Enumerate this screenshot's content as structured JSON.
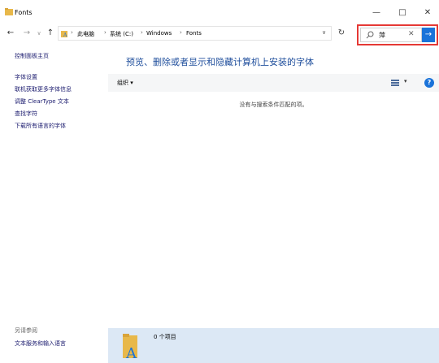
{
  "window": {
    "title": "Fonts",
    "minimize_glyph": "—",
    "maximize_glyph": "□",
    "close_glyph": "✕"
  },
  "nav": {
    "back_glyph": "←",
    "forward_glyph": "→",
    "recent_glyph": "∨",
    "up_glyph": "↑",
    "breadcrumbs": [
      "此电脑",
      "系统 (C:)",
      "Windows",
      "Fonts"
    ],
    "dropdown_glyph": "∨",
    "refresh_glyph": "↻"
  },
  "search": {
    "value": "萍",
    "clear_glyph": "✕",
    "go_glyph": "→"
  },
  "sidebar": {
    "home": "控制面板主页",
    "links": [
      "字体设置",
      "联机获取更多字体信息",
      "调整 ClearType 文本",
      "查找字符",
      "下载所有语言的字体"
    ],
    "see_also": "另请参阅",
    "see_also_link": "文本服务和输入语言"
  },
  "main": {
    "title": "预览、删除或者显示和隐藏计算机上安装的字体",
    "organize": "组织 ▾",
    "view_dropdown": "▾",
    "help_glyph": "?",
    "empty_message": "没有与搜索条件匹配的项。"
  },
  "details": {
    "count": "0 个项目"
  },
  "colors": {
    "accent": "#1a73d9",
    "title_blue": "#1f4e9c",
    "highlight_border": "#e53935",
    "details_bg": "#dce8f5"
  }
}
